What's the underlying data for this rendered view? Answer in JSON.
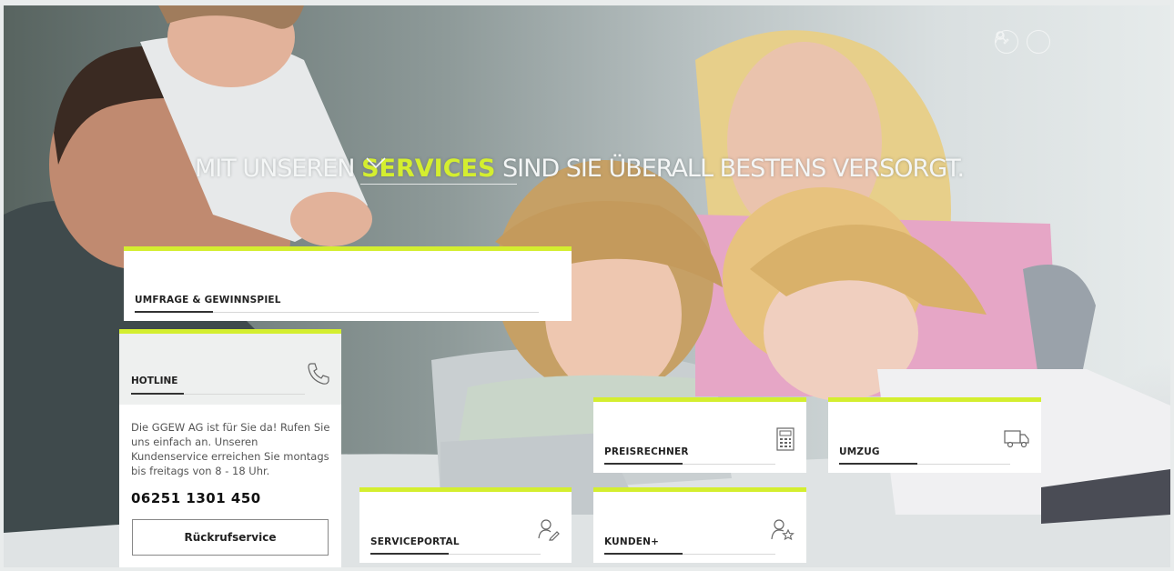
{
  "hero": {
    "headline_before": "MIT UNSEREN",
    "headline_highlight": "SERVICES",
    "headline_after": "SIND SIE ÜBERALL BESTENS VERSORGT."
  },
  "top_icons": [
    "search-icon",
    "user-edit-icon"
  ],
  "tiles": {
    "umfrage": {
      "label": "UMFRAGE & GEWINNSPIEL"
    },
    "preisrechner": {
      "label": "PREISRECHNER",
      "icon": "calculator-icon"
    },
    "umzug": {
      "label": "UMZUG",
      "icon": "truck-icon"
    },
    "serviceportal": {
      "label": "SERVICEPORTAL",
      "icon": "user-edit-icon"
    },
    "kunden": {
      "label": "KUNDEN+",
      "icon": "user-star-icon"
    }
  },
  "hotline": {
    "label": "HOTLINE",
    "text": "Die GGEW AG ist für Sie da! Rufen Sie uns einfach an. Unseren Kundenservice erreichen Sie montags bis freitags von 8 - 18 Uhr.",
    "phone": "06251 1301 450",
    "button": "Rückrufservice",
    "icon": "phone-icon"
  },
  "colors": {
    "accent": "#d4ee2f",
    "tile_bg": "#ffffff",
    "text_dark": "#222222"
  }
}
